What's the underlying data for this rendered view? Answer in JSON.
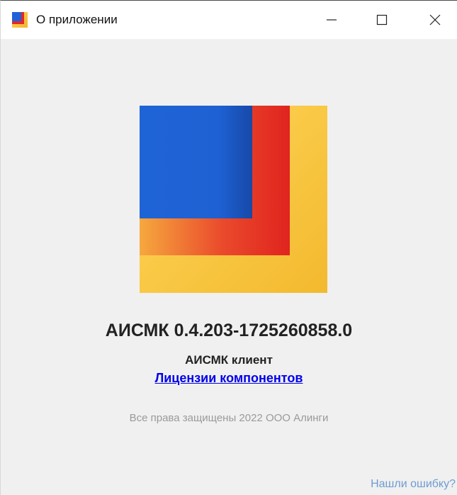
{
  "window": {
    "title": "О приложении",
    "controls": {
      "minimize_icon": "minimize-icon",
      "maximize_icon": "maximize-icon",
      "close_icon": "close-icon"
    }
  },
  "about": {
    "version": "АИСМК 0.4.203-1725260858.0",
    "client_name": "АИСМК клиент",
    "licenses_link": "Лицензии компонентов",
    "copyright": "Все права защищены 2022 ООО Алинги",
    "report_link": "Нашли ошибку?"
  },
  "colors": {
    "blue": "#1f63d8",
    "red": "#e3272a",
    "orange": "#f08a33",
    "yellow": "#f5c23a",
    "link": "#0000ee",
    "report_link": "#6f9bd1"
  }
}
